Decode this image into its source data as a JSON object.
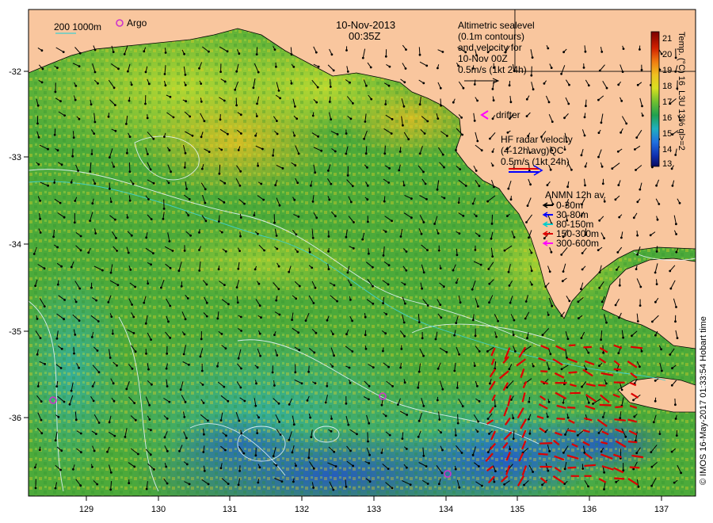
{
  "title": {
    "date": "10-Nov-2013",
    "time": "00:35Z"
  },
  "depth_legend": {
    "contours": "200  1000m",
    "argo": "Argo"
  },
  "altimetry_note": [
    "Altimetric sealevel",
    "(0.1m contours)",
    "and velocity for",
    "10-Nov 00Z",
    "0.5m/s (1kt 24h)"
  ],
  "drifter_label": "drifter",
  "hf_radar_note": [
    "HF radar velocity",
    "(4-12h avg)QC",
    "0.5m/s (1kt 24h)"
  ],
  "anmn": {
    "title": "ANMN 12h av.",
    "items": [
      {
        "label": "0-30m",
        "color": "#000000"
      },
      {
        "label": "30-80m",
        "color": "#0000ff"
      },
      {
        "label": "80-150m",
        "color": "#00cccc"
      },
      {
        "label": "150-300m",
        "color": "#dd0000"
      },
      {
        "label": "300-600m",
        "color": "#ff00ff"
      }
    ]
  },
  "colorbar": {
    "title": "Temp. (°C) 16_L3U 13% ql>=2",
    "ticks": [
      "21",
      "20",
      "19",
      "18",
      "17",
      "16",
      "15",
      "14",
      "13"
    ],
    "min": 13,
    "max": 21.5
  },
  "axes": {
    "x_ticks": [
      "129",
      "130",
      "131",
      "132",
      "133",
      "134",
      "135",
      "136",
      "137"
    ],
    "y_ticks": [
      "-32",
      "-33",
      "-34",
      "-35",
      "-36"
    ]
  },
  "credit": "© IMOS 16-May-2017 01:33:54 Hobart time",
  "colors": {
    "land": "#f9c69e",
    "sea": "#4caa3a",
    "radar": "#dd0000",
    "argo": "#cc33cc"
  },
  "chart_data": {
    "type": "heatmap",
    "description": "Sea surface temperature map with current vectors",
    "x": [
      "129",
      "130",
      "131",
      "132",
      "133",
      "134",
      "135",
      "136",
      "137"
    ],
    "y": [
      "-32",
      "-33",
      "-34",
      "-35",
      "-36"
    ],
    "value_range": [
      13,
      21.5
    ],
    "argo_floats": [
      [
        128.55,
        -35.8
      ],
      [
        133.15,
        -35.75
      ],
      [
        134.05,
        -36.65
      ]
    ]
  }
}
